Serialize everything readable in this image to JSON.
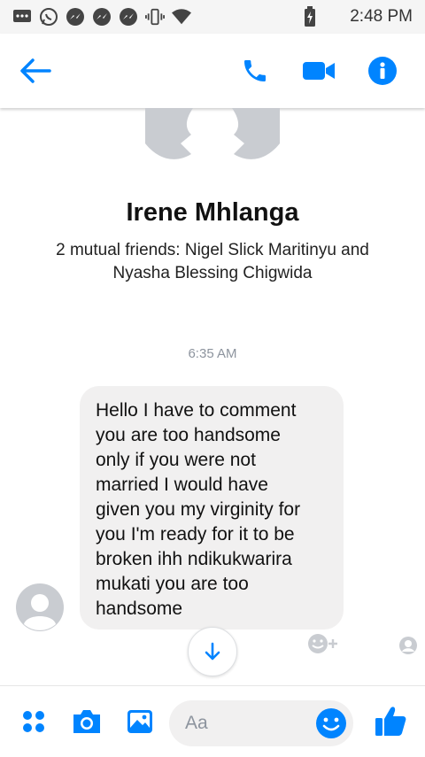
{
  "status_bar": {
    "time": "2:48 PM",
    "icons": [
      "chat-bubble-icon",
      "whatsapp-icon",
      "messenger-icon",
      "messenger-icon",
      "messenger-icon",
      "vibrate-icon",
      "wifi-icon",
      "battery-charging-icon"
    ]
  },
  "header": {
    "back_icon": "arrow-left-icon",
    "actions": [
      "phone-icon",
      "video-camera-icon",
      "info-icon"
    ]
  },
  "contact": {
    "name": "Irene Mhlanga",
    "mutual_line1": "2 mutual friends: Nigel Slick Maritinyu and",
    "mutual_line2": "Nyasha Blessing Chigwida"
  },
  "conversation": {
    "timestamp": "6:35 AM",
    "messages": [
      {
        "lines": [
          "Hello I have to comment",
          "you are too handsome",
          "only if you were not",
          "married I would have",
          "given you my virginity for",
          "you I'm ready for it to be",
          "broken ihh ndikukwarira",
          "mukati you are too",
          "handsome"
        ]
      }
    ]
  },
  "composer": {
    "placeholder": "Aa",
    "icons": [
      "more-apps-icon",
      "camera-icon",
      "gallery-icon",
      "emoji-icon",
      "thumbs-up-icon"
    ]
  },
  "colors": {
    "accent": "#0084ff",
    "bubble": "#f1f0f0",
    "muted_text": "#8d949e"
  }
}
